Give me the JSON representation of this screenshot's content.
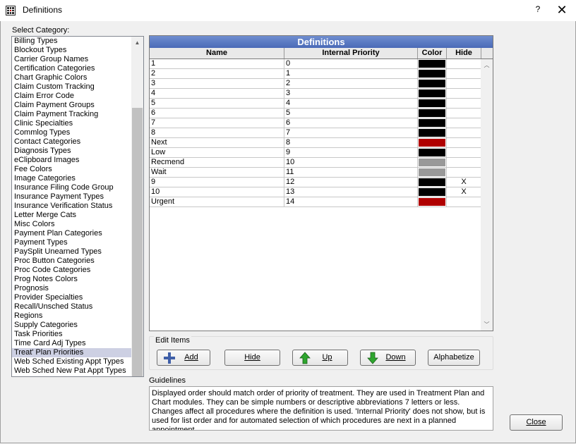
{
  "window": {
    "title": "Definitions",
    "help_label": "?",
    "close_label": "✕"
  },
  "category_label": "Select Category:",
  "categories": [
    "Billing Types",
    "Blockout Types",
    "Carrier Group Names",
    "Certification Categories",
    "Chart Graphic Colors",
    "Claim Custom Tracking",
    "Claim Error Code",
    "Claim Payment Groups",
    "Claim Payment Tracking",
    "Clinic Specialties",
    "Commlog Types",
    "Contact Categories",
    "Diagnosis Types",
    "eClipboard Images",
    "Fee Colors",
    "Image Categories",
    "Insurance Filing Code Group",
    "Insurance Payment Types",
    "Insurance Verification Status",
    "Letter Merge Cats",
    "Misc Colors",
    "Payment Plan Categories",
    "Payment Types",
    "PaySplit Unearned Types",
    "Proc Button Categories",
    "Proc Code Categories",
    "Prog Notes Colors",
    "Prognosis",
    "Provider Specialties",
    "Recall/Unsched Status",
    "Regions",
    "Supply Categories",
    "Task Priorities",
    "Time Card Adj Types",
    "Treat' Plan Priorities",
    "Web Sched Existing Appt Types",
    "Web Sched New Pat Appt Types"
  ],
  "selected_category": "Treat' Plan Priorities",
  "grid": {
    "title": "Definitions",
    "columns": {
      "name": "Name",
      "priority": "Internal Priority",
      "color": "Color",
      "hide": "Hide"
    },
    "rows": [
      {
        "name": "1",
        "priority": "0",
        "color": "#000000",
        "hide": ""
      },
      {
        "name": "2",
        "priority": "1",
        "color": "#000000",
        "hide": ""
      },
      {
        "name": "3",
        "priority": "2",
        "color": "#000000",
        "hide": ""
      },
      {
        "name": "4",
        "priority": "3",
        "color": "#000000",
        "hide": ""
      },
      {
        "name": "5",
        "priority": "4",
        "color": "#000000",
        "hide": ""
      },
      {
        "name": "6",
        "priority": "5",
        "color": "#000000",
        "hide": ""
      },
      {
        "name": "7",
        "priority": "6",
        "color": "#000000",
        "hide": ""
      },
      {
        "name": "8",
        "priority": "7",
        "color": "#000000",
        "hide": ""
      },
      {
        "name": "Next",
        "priority": "8",
        "color": "#b00000",
        "hide": ""
      },
      {
        "name": "Low",
        "priority": "9",
        "color": "#000000",
        "hide": ""
      },
      {
        "name": "Recmend",
        "priority": "10",
        "color": "#999999",
        "hide": ""
      },
      {
        "name": "Wait",
        "priority": "11",
        "color": "#999999",
        "hide": ""
      },
      {
        "name": "9",
        "priority": "12",
        "color": "#000000",
        "hide": "X"
      },
      {
        "name": "10",
        "priority": "13",
        "color": "#000000",
        "hide": "X"
      },
      {
        "name": "Urgent",
        "priority": "14",
        "color": "#b00000",
        "hide": ""
      }
    ]
  },
  "edit_items": {
    "title": "Edit Items",
    "add": "Add",
    "hide": "Hide",
    "up": "Up",
    "down": "Down",
    "alphabetize": "Alphabetize"
  },
  "guidelines": {
    "title": "Guidelines",
    "text": "Displayed order should match order of priority of treatment.  They are used in Treatment Plan and Chart modules. They can be simple numbers or descriptive abbreviations 7 letters or less.  Changes affect all procedures where the definition is used.  'Internal Priority' does not show, but is used for list order and for automated selection of which procedures are next in a planned appointment."
  },
  "close_button": "Close",
  "icons": {
    "app": "grid-app-icon",
    "add": "plus-icon",
    "up": "up-arrow-icon",
    "down": "down-arrow-icon"
  }
}
